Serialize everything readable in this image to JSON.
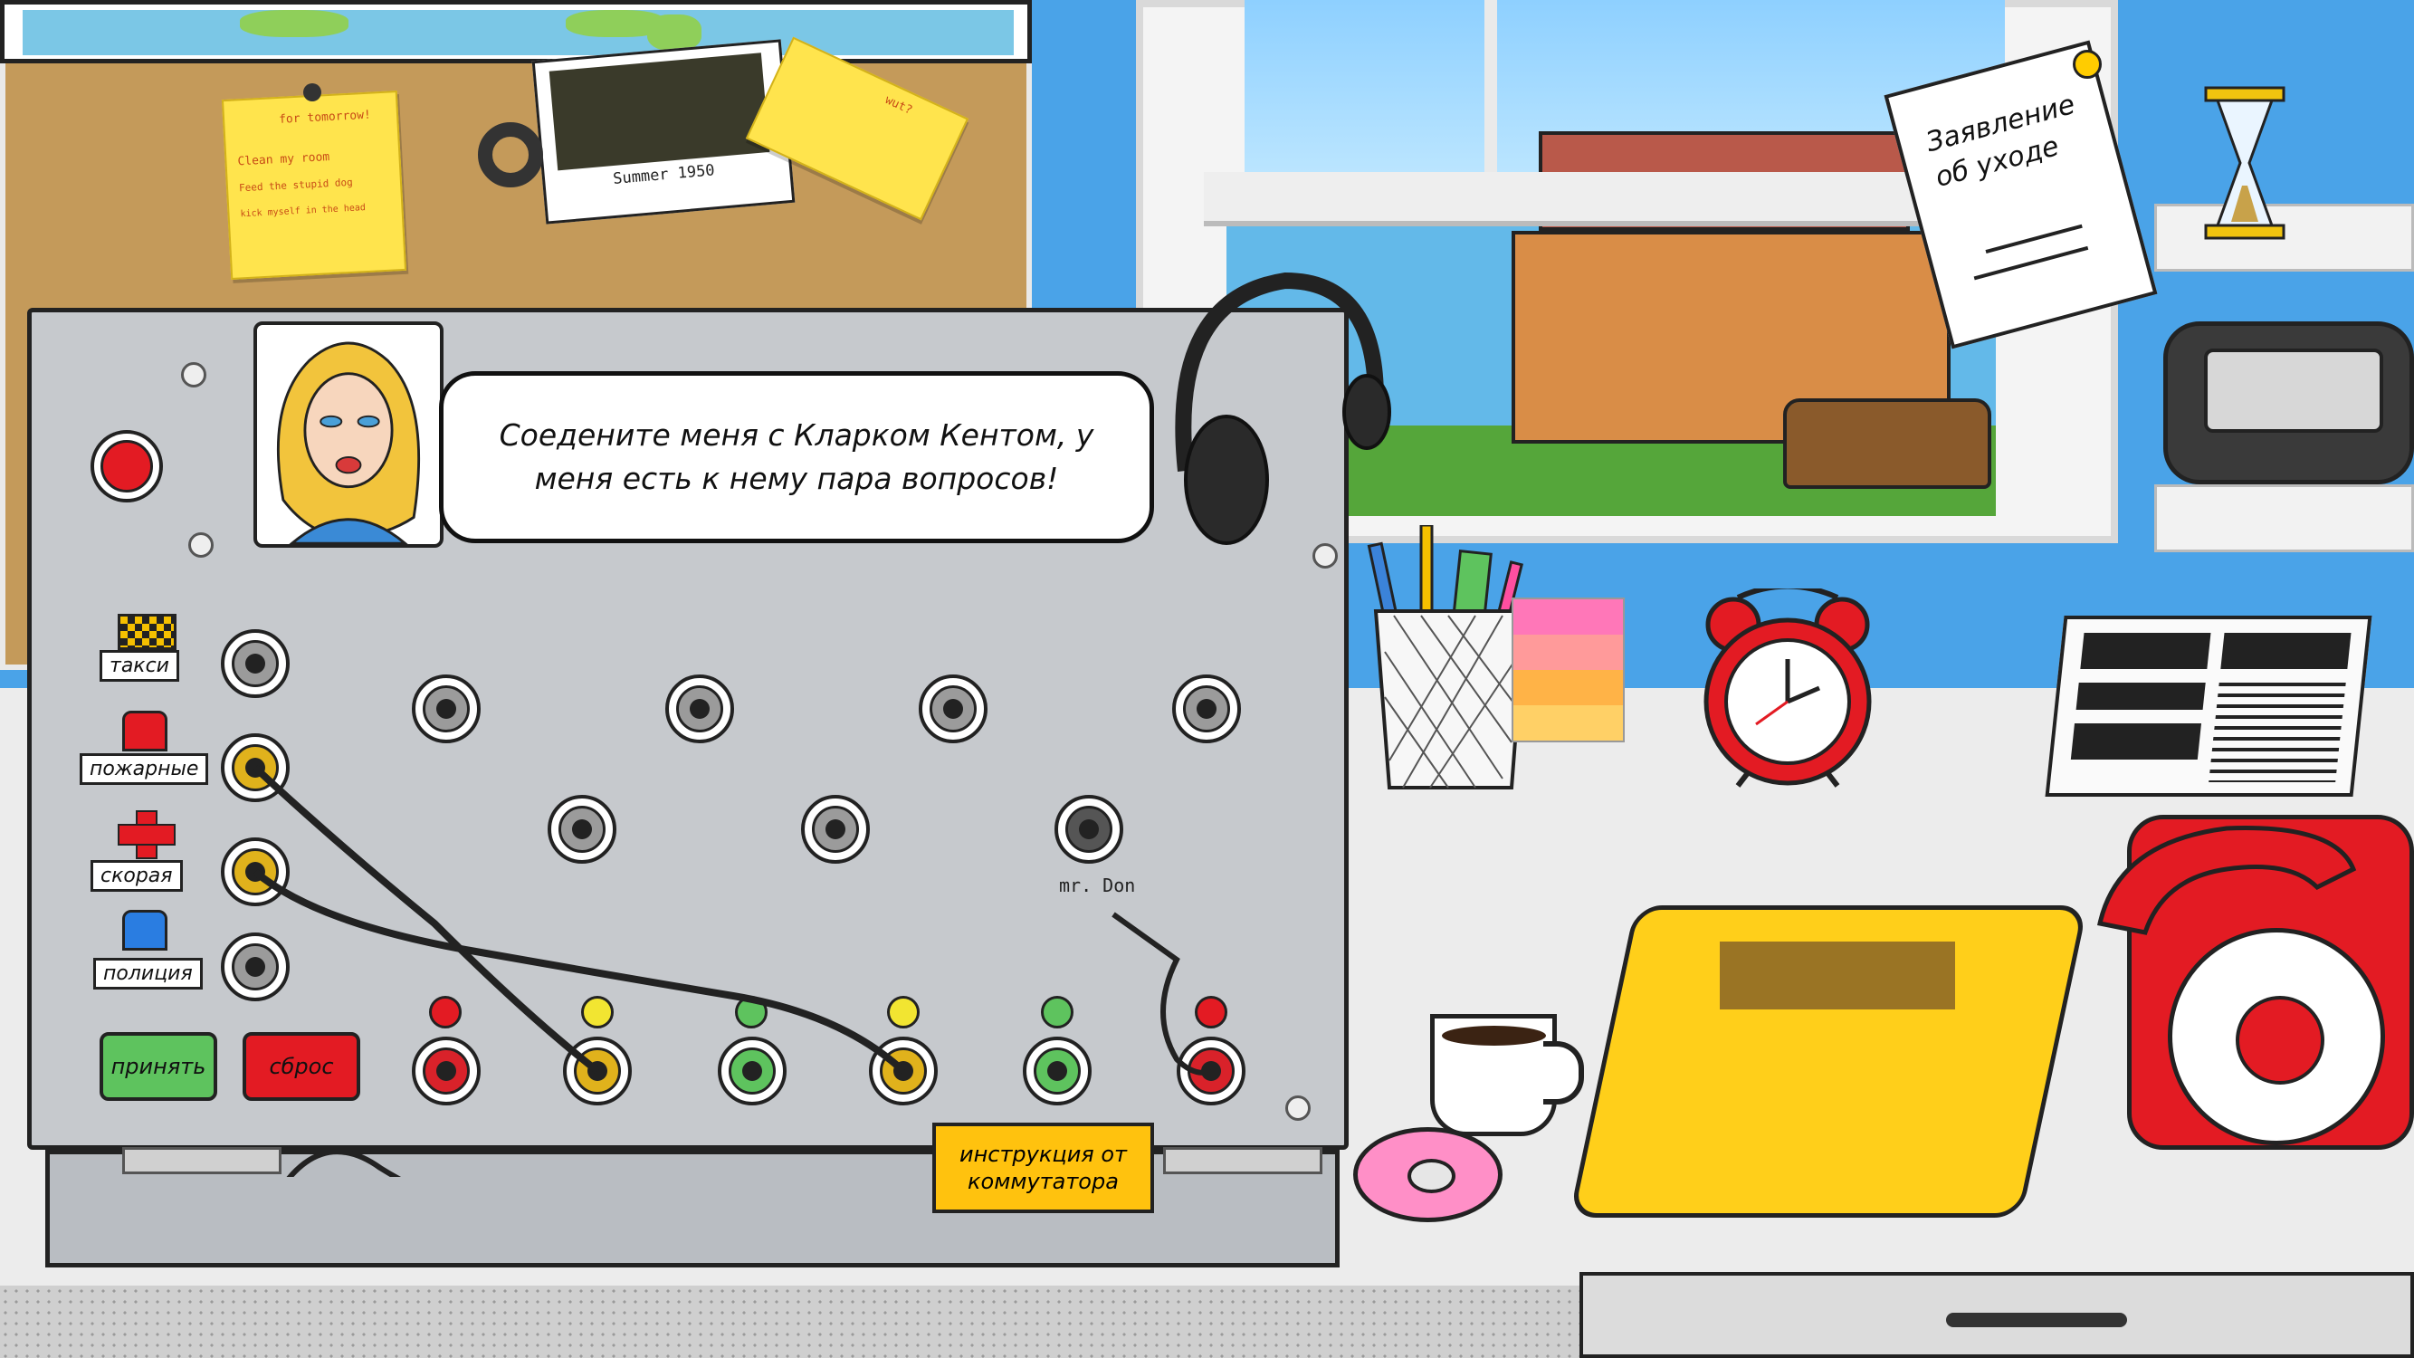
{
  "scene": {
    "board_note": {
      "lines": [
        "for tomorrow!",
        "Clean my room",
        "Feed the stupid dog",
        "kick myself in the head"
      ]
    },
    "photo_caption": "Summer 1950",
    "sticky_note": "wut?",
    "resignation_paper": "Заявление об уходе"
  },
  "caller": {
    "speech": "Соедените меня с Кларком Кентом, у меня есть к нему пара вопросов!"
  },
  "services": [
    {
      "id": "taxi",
      "label": "такси",
      "color": "#f5c000"
    },
    {
      "id": "fire",
      "label": "пожарные",
      "color": "#e31b23"
    },
    {
      "id": "ambulance",
      "label": "скорая",
      "color": "#e31b23"
    },
    {
      "id": "police",
      "label": "полиция",
      "color": "#2a7de1"
    }
  ],
  "jacks": {
    "named_jack_label": "mr. Don"
  },
  "controls": {
    "accept_label": "принять",
    "accept_color": "#5ec35e",
    "reset_label": "сброс",
    "reset_color": "#e31b23"
  },
  "manual": {
    "label": "инструкция от коммутатора"
  },
  "lamps": [
    {
      "color": "#e31b23"
    },
    {
      "color": "#f2e531"
    },
    {
      "color": "#5ec35e"
    },
    {
      "color": "#f2e531"
    },
    {
      "color": "#5ec35e"
    },
    {
      "color": "#e31b23"
    }
  ],
  "alarm_lamp_color": "#e31b23"
}
